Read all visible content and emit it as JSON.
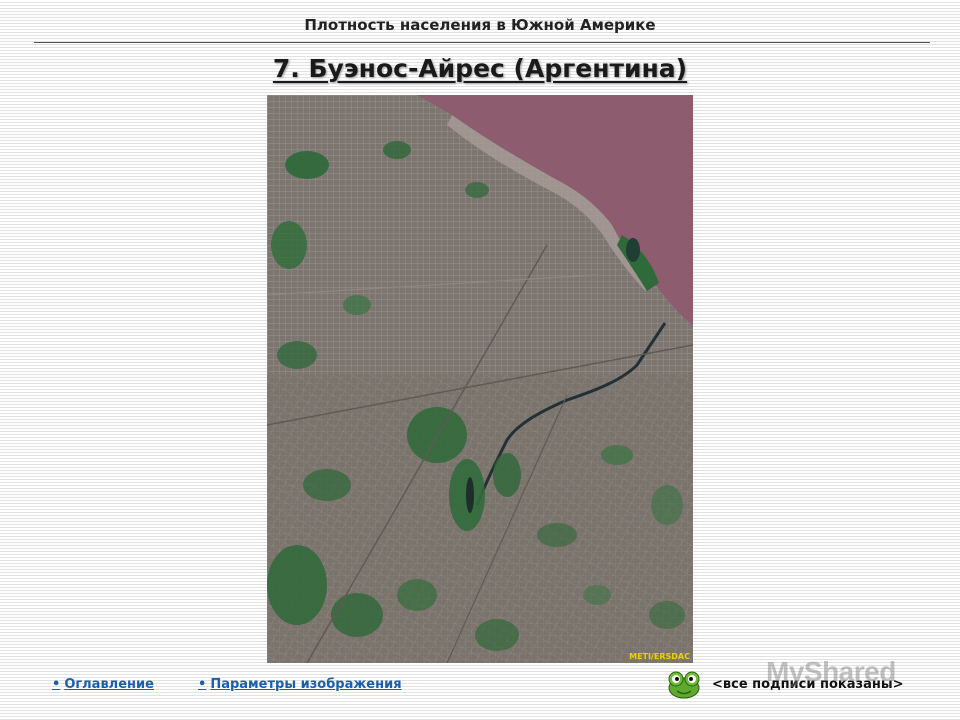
{
  "header": {
    "title": "Плотность населения в Южной Америке"
  },
  "slide": {
    "title": "7. Буэнос-Айрес (Аргентина)"
  },
  "image": {
    "credit": "METI/ERSDAC",
    "icon": "satellite-photo"
  },
  "footer": {
    "toc_label": "Оглавление",
    "params_label": "Параметры изображения",
    "captions_label": "<все подписи показаны>",
    "bullet": "•",
    "mascot_icon": "frog-icon"
  },
  "watermark": {
    "text": "MyShared"
  },
  "colors": {
    "link": "#1a5fa8",
    "water": "#8c5d6e",
    "urban": "#7a736d",
    "vegetation": "#2f6a38"
  }
}
